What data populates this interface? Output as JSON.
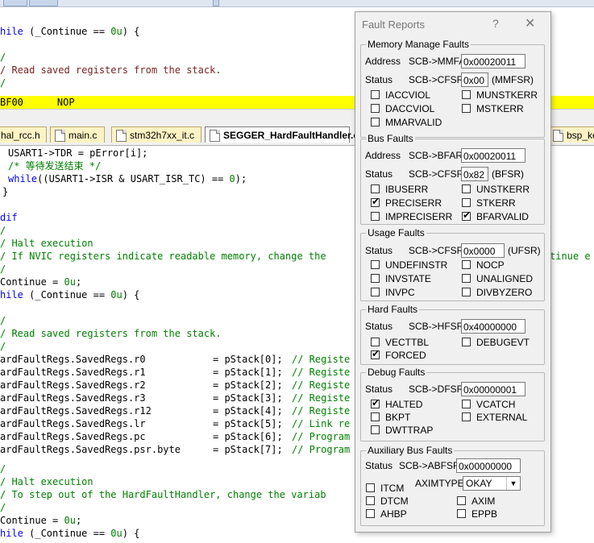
{
  "pane1": {
    "lines": [
      {
        "segments": [
          {
            "t": "hile (",
            "c": "kw-partial"
          }
        ]
      },
      {
        "segments": []
      },
      {
        "segments": []
      },
      {
        "segments": []
      },
      {
        "segments": []
      },
      {
        "segments": []
      },
      {
        "segments": []
      }
    ],
    "l1a": "hile",
    "l1b": " (_Continue == ",
    "l1c": "0u",
    "l1d": ") {",
    "l3": "/",
    "l4": "/ Read saved registers from the stack.",
    "l5": "/",
    "hl_addr": "BF00",
    "hl_op": "NOP"
  },
  "tabs": [
    {
      "label": "hal_rcc.h"
    },
    {
      "label": "main.c"
    },
    {
      "label": "stm32h7xx_it.c"
    },
    {
      "label": "SEGGER_HardFaultHandler.c"
    },
    {
      "label": "bsp_ke"
    }
  ],
  "code": {
    "c1": "USART1->TDR = pError[i];",
    "c2": "/* 等待发送结束 */",
    "c3a": "while",
    "c3b": "((USART1->ISR & USART_ISR_TC) == ",
    "c3c": "0",
    "c3d": ");",
    "c4": "}",
    "c6": "dif",
    "c7": "/",
    "c8": "/ Halt execution",
    "c9": "/ If NVIC registers indicate readable memory, change the",
    "c9r": "tinue e",
    "c10": "/",
    "c11a": "Continue = ",
    "c11b": "0u",
    "c11c": ";",
    "c12a": "hile",
    "c12b": " (_Continue == ",
    "c12c": "0u",
    "c12d": ") {",
    "c14": "/",
    "c15": "/ Read saved registers from the stack.",
    "c16": "/",
    "regs": [
      {
        "lhs": "ardFaultRegs.SavedRegs.r0",
        "rhs": "= pStack[0];",
        "cm": "// Registe"
      },
      {
        "lhs": "ardFaultRegs.SavedRegs.r1",
        "rhs": "= pStack[1];",
        "cm": "// Registe"
      },
      {
        "lhs": "ardFaultRegs.SavedRegs.r2",
        "rhs": "= pStack[2];",
        "cm": "// Registe"
      },
      {
        "lhs": "ardFaultRegs.SavedRegs.r3",
        "rhs": "= pStack[3];",
        "cm": "// Registe"
      },
      {
        "lhs": "ardFaultRegs.SavedRegs.r12",
        "rhs": "= pStack[4];",
        "cm": "// Registe"
      },
      {
        "lhs": "ardFaultRegs.SavedRegs.lr",
        "rhs": "= pStack[5];",
        "cm": "// Link re"
      },
      {
        "lhs": "ardFaultRegs.SavedRegs.pc",
        "rhs": "= pStack[6];",
        "cm": "// Program"
      },
      {
        "lhs": "ardFaultRegs.SavedRegs.psr.byte",
        "rhs": "= pStack[7];",
        "cm": "// Program"
      }
    ],
    "c25": "/",
    "c26": "/ Halt execution",
    "c27": "/ To step out of the HardFaultHandler, change the variab",
    "c28": "/",
    "c29a": "Continue = ",
    "c29b": "0u",
    "c29c": ";",
    "c30a": "hile",
    "c30b": " (_Continue == ",
    "c30c": "0u",
    "c30d": ") {"
  },
  "dialog": {
    "title": "Fault Reports",
    "help": "?",
    "close": "✕",
    "mm": {
      "title": "Memory Manage Faults",
      "address_label": "Address",
      "reg_label": "SCB->MMFAR:",
      "reg_value": "0x00020011",
      "status_label": "Status",
      "cfsr_label": "SCB->CFSR:",
      "cfsr_value": "0x00",
      "cfsr_suffix": "(MMFSR)",
      "flags": [
        {
          "label": "IACCVIOL",
          "checked": false
        },
        {
          "label": "MUNSTKERR",
          "checked": false
        },
        {
          "label": "DACCVIOL",
          "checked": false
        },
        {
          "label": "MSTKERR",
          "checked": false
        },
        {
          "label": "MMARVALID",
          "checked": false
        }
      ]
    },
    "bus": {
      "title": "Bus Faults",
      "address_label": "Address",
      "reg_label": "SCB->BFAR:",
      "reg_value": "0x00020011",
      "status_label": "Status",
      "cfsr_label": "SCB->CFSR:",
      "cfsr_value": "0x82",
      "cfsr_suffix": "(BFSR)",
      "flags": [
        {
          "label": "IBUSERR",
          "checked": false
        },
        {
          "label": "UNSTKERR",
          "checked": false
        },
        {
          "label": "PRECISERR",
          "checked": true
        },
        {
          "label": "STKERR",
          "checked": false
        },
        {
          "label": "IMPRECISERR",
          "checked": false
        },
        {
          "label": "BFARVALID",
          "checked": true
        }
      ]
    },
    "usage": {
      "title": "Usage Faults",
      "status_label": "Status",
      "cfsr_label": "SCB->CFSR:",
      "cfsr_value": "0x0000",
      "cfsr_suffix": "(UFSR)",
      "flags": [
        {
          "label": "UNDEFINSTR",
          "checked": false
        },
        {
          "label": "NOCP",
          "checked": false
        },
        {
          "label": "INVSTATE",
          "checked": false
        },
        {
          "label": "UNALIGNED",
          "checked": false
        },
        {
          "label": "INVPC",
          "checked": false
        },
        {
          "label": "DIVBYZERO",
          "checked": false
        }
      ]
    },
    "hard": {
      "title": "Hard Faults",
      "status_label": "Status",
      "reg_label": "SCB->HFSR:",
      "reg_value": "0x40000000",
      "flags": [
        {
          "label": "VECTTBL",
          "checked": false
        },
        {
          "label": "DEBUGEVT",
          "checked": false
        },
        {
          "label": "FORCED",
          "checked": true
        }
      ]
    },
    "debug": {
      "title": "Debug Faults",
      "status_label": "Status",
      "reg_label": "SCB->DFSR",
      "reg_value": "0x00000001",
      "flags": [
        {
          "label": "HALTED",
          "checked": true
        },
        {
          "label": "VCATCH",
          "checked": false
        },
        {
          "label": "BKPT",
          "checked": false
        },
        {
          "label": "EXTERNAL",
          "checked": false
        },
        {
          "label": "DWTTRAP",
          "checked": false
        }
      ]
    },
    "aux": {
      "title": "Auxiliary Bus Faults",
      "status_label": "Status",
      "reg_label": "SCB->ABFSR:",
      "reg_value": "0x00000000",
      "axim_label": "AXIMTYPE:",
      "axim_value": "OKAY",
      "flags": [
        {
          "label": "ITCM",
          "checked": false
        },
        {
          "label": "DTCM",
          "checked": false
        },
        {
          "label": "AXIM",
          "checked": false
        },
        {
          "label": "AHBP",
          "checked": false
        },
        {
          "label": "EPPB",
          "checked": false
        }
      ]
    }
  }
}
